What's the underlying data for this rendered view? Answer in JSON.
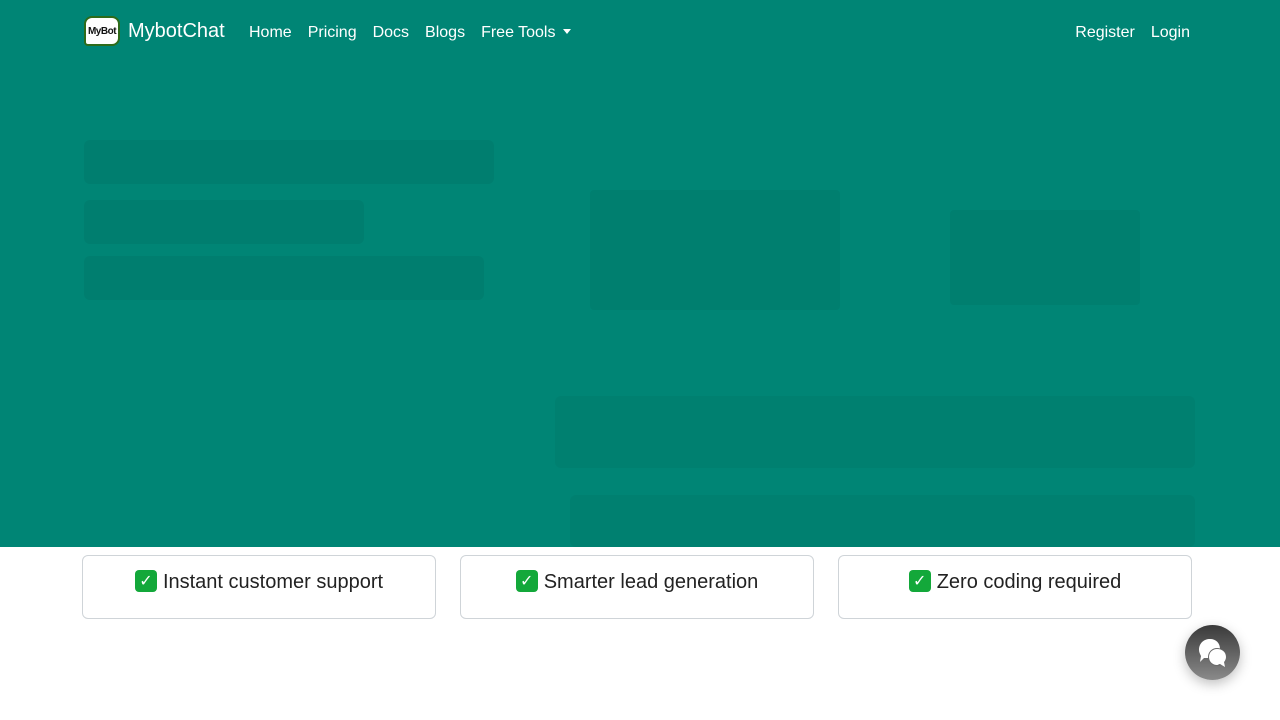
{
  "brand": {
    "logo_text": "MyBot",
    "name": "MybotChat",
    "logo_icon": "speech-bubble-logo"
  },
  "nav": {
    "links": [
      "Home",
      "Pricing",
      "Docs",
      "Blogs"
    ],
    "dropdown_label": "Free Tools",
    "register_label": "Register",
    "login_label": "Login"
  },
  "features": [
    {
      "icon": "check-mark-button",
      "text": "Instant customer support"
    },
    {
      "icon": "check-mark-button",
      "text": "Smarter lead generation"
    },
    {
      "icon": "check-mark-button",
      "text": "Zero coding required"
    }
  ],
  "chat_widget": {
    "icon": "chat-bubbles-icon"
  },
  "colors": {
    "hero_bg": "#008575",
    "check_bg": "#13a83a",
    "card_border": "#cfd4d8"
  }
}
